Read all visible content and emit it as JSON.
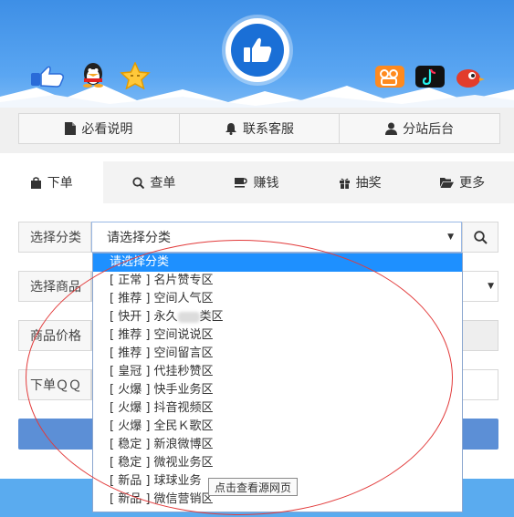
{
  "nav": {
    "items": [
      {
        "label": "必看说明",
        "icon": "document-icon"
      },
      {
        "label": "联系客服",
        "icon": "bell-icon"
      },
      {
        "label": "分站后台",
        "icon": "user-icon"
      }
    ]
  },
  "tabs": [
    {
      "label": "下单",
      "icon": "shopping-bag-icon",
      "active": true
    },
    {
      "label": "查单",
      "icon": "search-icon"
    },
    {
      "label": "赚钱",
      "icon": "coffee-cup-icon"
    },
    {
      "label": "抽奖",
      "icon": "gift-icon"
    },
    {
      "label": "更多",
      "icon": "folder-open-icon"
    }
  ],
  "form": {
    "category_label": "选择分类",
    "category_value": "请选择分类",
    "product_label": "选择商品",
    "price_label": "商品价格",
    "qq_label": "下单ＱＱ"
  },
  "dropdown": {
    "options": [
      "请选择分类",
      "[ 正常 ] 名片赞专区",
      "[ 推荐 ] 空间人气区",
      "[ 快开 ] 永久",
      "[ 推荐 ] 空间说说区",
      "[ 推荐 ] 空间留言区",
      "[ 皇冠 ] 代挂秒赞区",
      "[ 火爆 ] 快手业务区",
      "[ 火爆 ] 抖音视频区",
      "[ 火爆 ] 全民Ｋ歌区",
      "[ 稳定 ] 新浪微博区",
      "[ 稳定 ] 微视业务区",
      "[ 新品 ] 球球业务",
      "[ 新品 ] 微信营销区"
    ],
    "blurred_suffix": "类区"
  },
  "tooltip": "点击查看源网页",
  "colors": {
    "header_blue": "#3e8fe6",
    "selected_option": "#1e90ff",
    "annotation_red": "#e23b3b",
    "submit_blue": "#5c8fd6"
  }
}
